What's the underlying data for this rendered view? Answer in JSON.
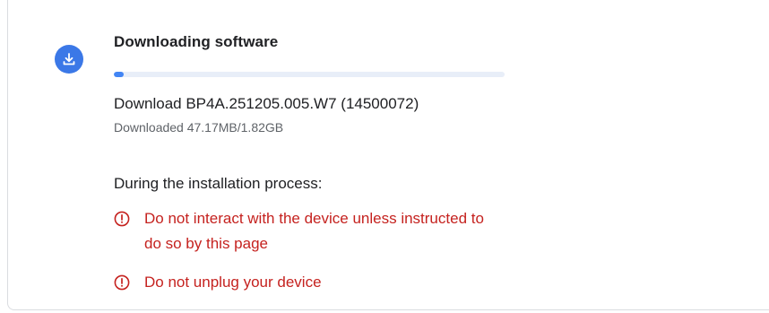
{
  "status": {
    "title": "Downloading software",
    "icon": "download-icon",
    "accent_color": "#3b78e7",
    "progress_percent": 2.6
  },
  "build": {
    "label": "Download BP4A.251205.005.W7 (14500072)",
    "downloaded": "Downloaded 47.17MB/1.82GB"
  },
  "instructions": {
    "heading": "During the installation process:",
    "warning_color": "#c5221f",
    "warnings": [
      {
        "icon": "alert-circle-icon",
        "text": "Do not interact with the device unless instructed to do so by this page"
      },
      {
        "icon": "alert-circle-icon",
        "text": "Do not unplug your device"
      }
    ]
  }
}
